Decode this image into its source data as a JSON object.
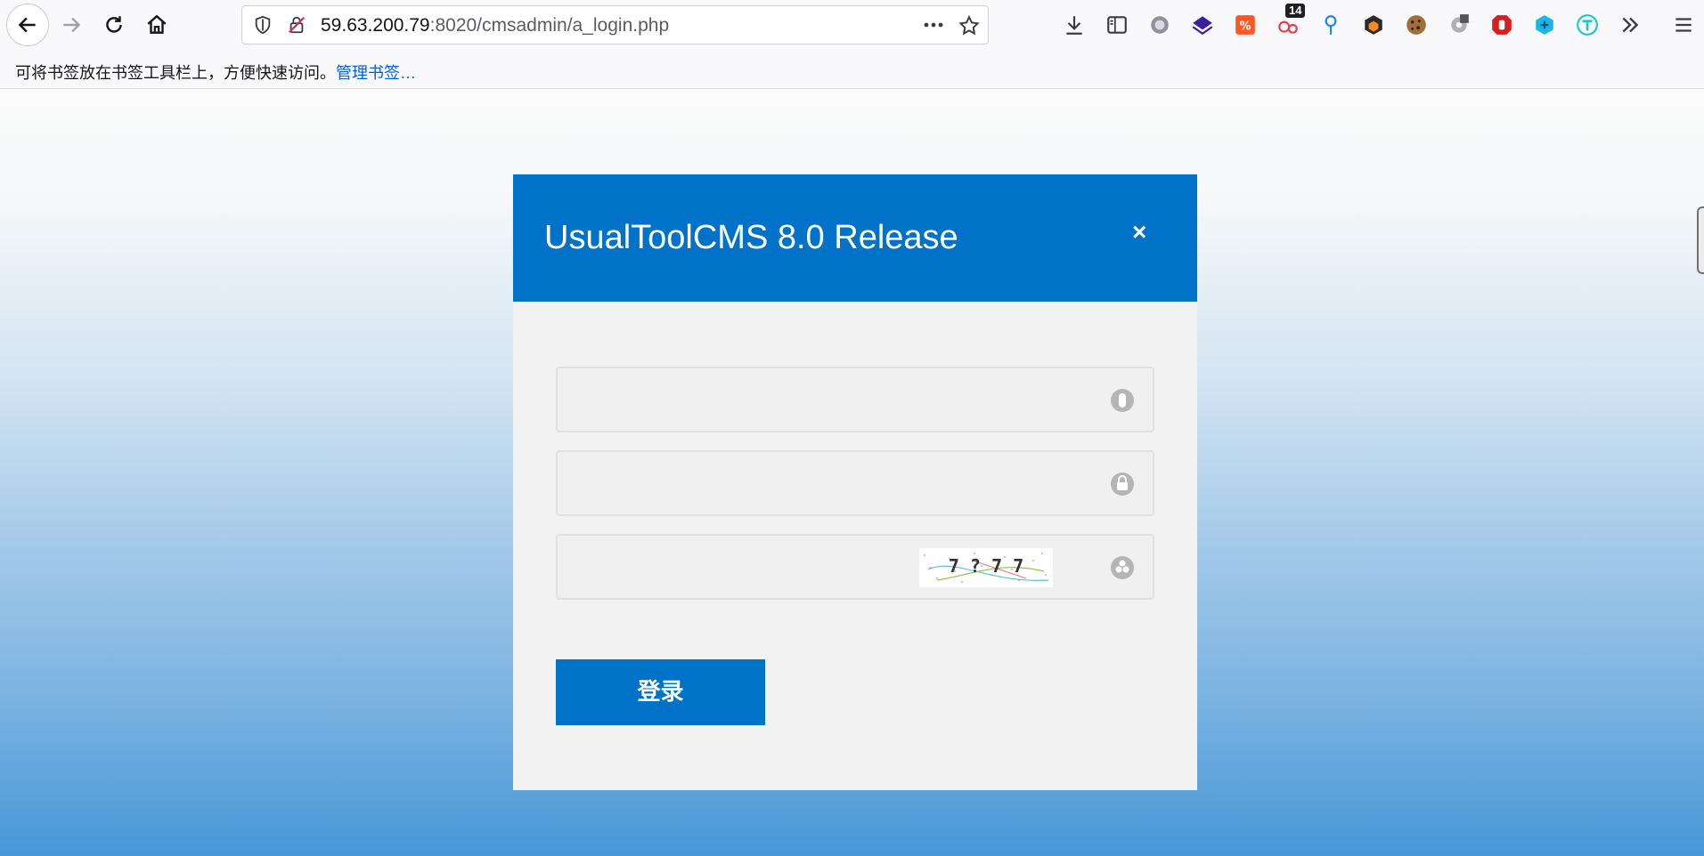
{
  "browser": {
    "url_host": "59.63.200.79",
    "url_port_path": ":8020/cmsadmin/a_login.php",
    "extension_badge": "14"
  },
  "bookmarks_bar": {
    "hint": "可将书签放在书签工具栏上，方便快速访问。",
    "manage_link": "管理书签…"
  },
  "modal": {
    "title": "UsualToolCMS 8.0 Release",
    "close_symbol": "×",
    "username": {
      "value": "",
      "icon": "user-icon"
    },
    "password": {
      "value": "",
      "icon": "lock-icon"
    },
    "captcha": {
      "value": "",
      "icon": "captcha-refresh-icon",
      "image_text": "7 ? 7 7"
    },
    "login_label": "登录",
    "accent_color": "#0073c8"
  }
}
